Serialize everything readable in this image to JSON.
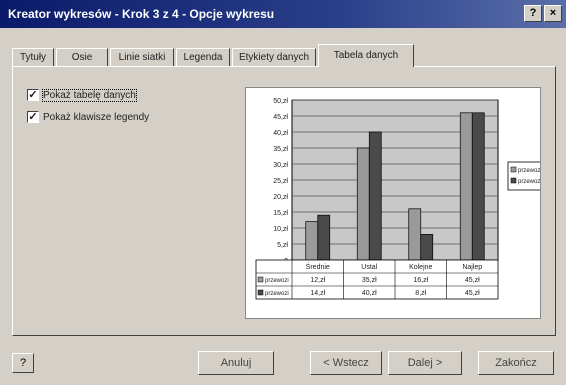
{
  "window": {
    "title": "Kreator wykresów - Krok 3 z 4 - Opcje wykresu"
  },
  "titlebar": {
    "help_label": "?",
    "close_label": "×"
  },
  "tabs": [
    {
      "label": "Tytuły"
    },
    {
      "label": "Osie"
    },
    {
      "label": "Linie siatki"
    },
    {
      "label": "Legenda"
    },
    {
      "label": "Etykiety danych"
    },
    {
      "label": "Tabela danych",
      "active": true
    }
  ],
  "options": {
    "show_data_table": {
      "label": "Pokaż tabelę danych",
      "checked": true
    },
    "show_legend_keys": {
      "label": "Pokaż klawisze legendy",
      "checked": true
    }
  },
  "chart_data": {
    "type": "bar",
    "categories": [
      "Średnie",
      "Ustal",
      "Kolejne",
      "Najlep"
    ],
    "series": [
      {
        "name": "przewozi",
        "values": [
          12,
          35,
          16,
          46
        ],
        "labels": [
          "12,zł",
          "35,zł",
          "16,zł",
          "45,zł"
        ],
        "color": "#9a9a9a"
      },
      {
        "name": "przewozi",
        "values": [
          14,
          40,
          8,
          46
        ],
        "labels": [
          "14,zł",
          "40,zł",
          "8,zł",
          "45,zł"
        ],
        "color": "#4a4a4a"
      }
    ],
    "ylim": [
      0,
      50
    ],
    "yticks": [
      "0",
      "5,zł",
      "10,zł",
      "15,zł",
      "20,zł",
      "25,zł",
      "30,zł",
      "35,zł",
      "40,zł",
      "45,zł",
      "50,zł"
    ],
    "grid": true,
    "legend": "right"
  },
  "buttons": {
    "help": "?",
    "cancel": "Anuluj",
    "back": "< Wstecz",
    "next": "Dalej >",
    "finish": "Zakończ"
  }
}
